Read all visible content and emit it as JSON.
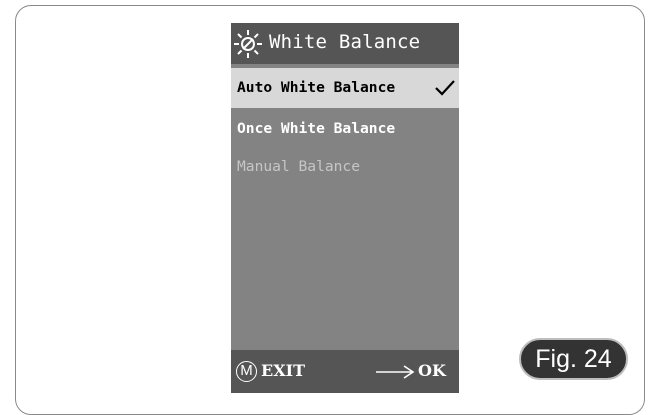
{
  "header": {
    "icon": "white-balance-icon",
    "title": "White Balance"
  },
  "menu": {
    "items": [
      {
        "label": "Auto White Balance",
        "selected": true,
        "state": "active"
      },
      {
        "label": "Once White Balance",
        "selected": false,
        "state": "normal"
      },
      {
        "label": "Manual Balance",
        "selected": false,
        "state": "disabled"
      }
    ]
  },
  "footer": {
    "m_icon_label": "M",
    "exit_label": "EXIT",
    "arrow_icon": "arrow-right-icon",
    "ok_label": "OK"
  },
  "figure_label": "Fig. 24",
  "colors": {
    "screen_bg": "#838383",
    "header_bg": "#555555",
    "selected_bg": "#d8d8d8",
    "badge_bg": "#333333"
  }
}
